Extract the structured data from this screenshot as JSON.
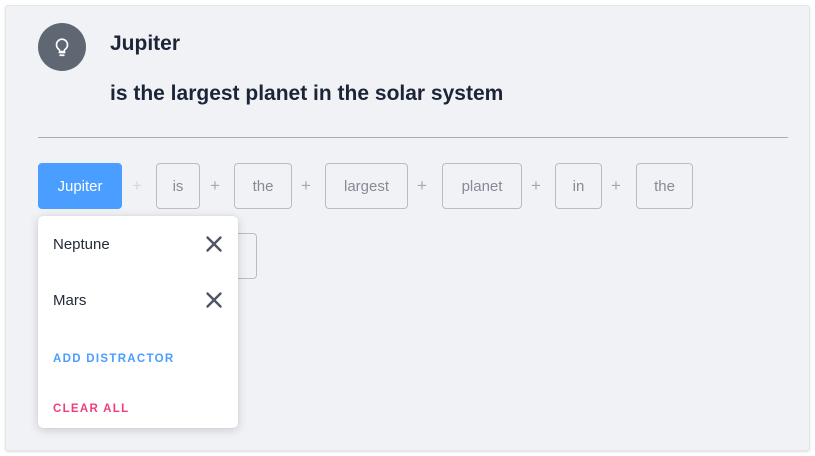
{
  "header": {
    "answer": "Jupiter",
    "sentence": "is the largest planet in the solar system",
    "icon": "lightbulb-icon"
  },
  "tokens": [
    {
      "label": "Jupiter",
      "selected": true
    },
    {
      "label": "is"
    },
    {
      "label": "the"
    },
    {
      "label": "largest"
    },
    {
      "label": "planet"
    },
    {
      "label": "in"
    },
    {
      "label": "the"
    }
  ],
  "separator": "+",
  "dropdown": {
    "options": [
      {
        "label": "Neptune",
        "remove_icon": "close-icon"
      },
      {
        "label": "Mars",
        "remove_icon": "close-icon"
      }
    ],
    "add_label": "ADD DISTRACTOR",
    "clear_label": "CLEAR ALL"
  },
  "colors": {
    "accent": "#4a9eff",
    "danger": "#ef3f7b",
    "heading": "#1c2538",
    "background": "#f1f2f6"
  }
}
